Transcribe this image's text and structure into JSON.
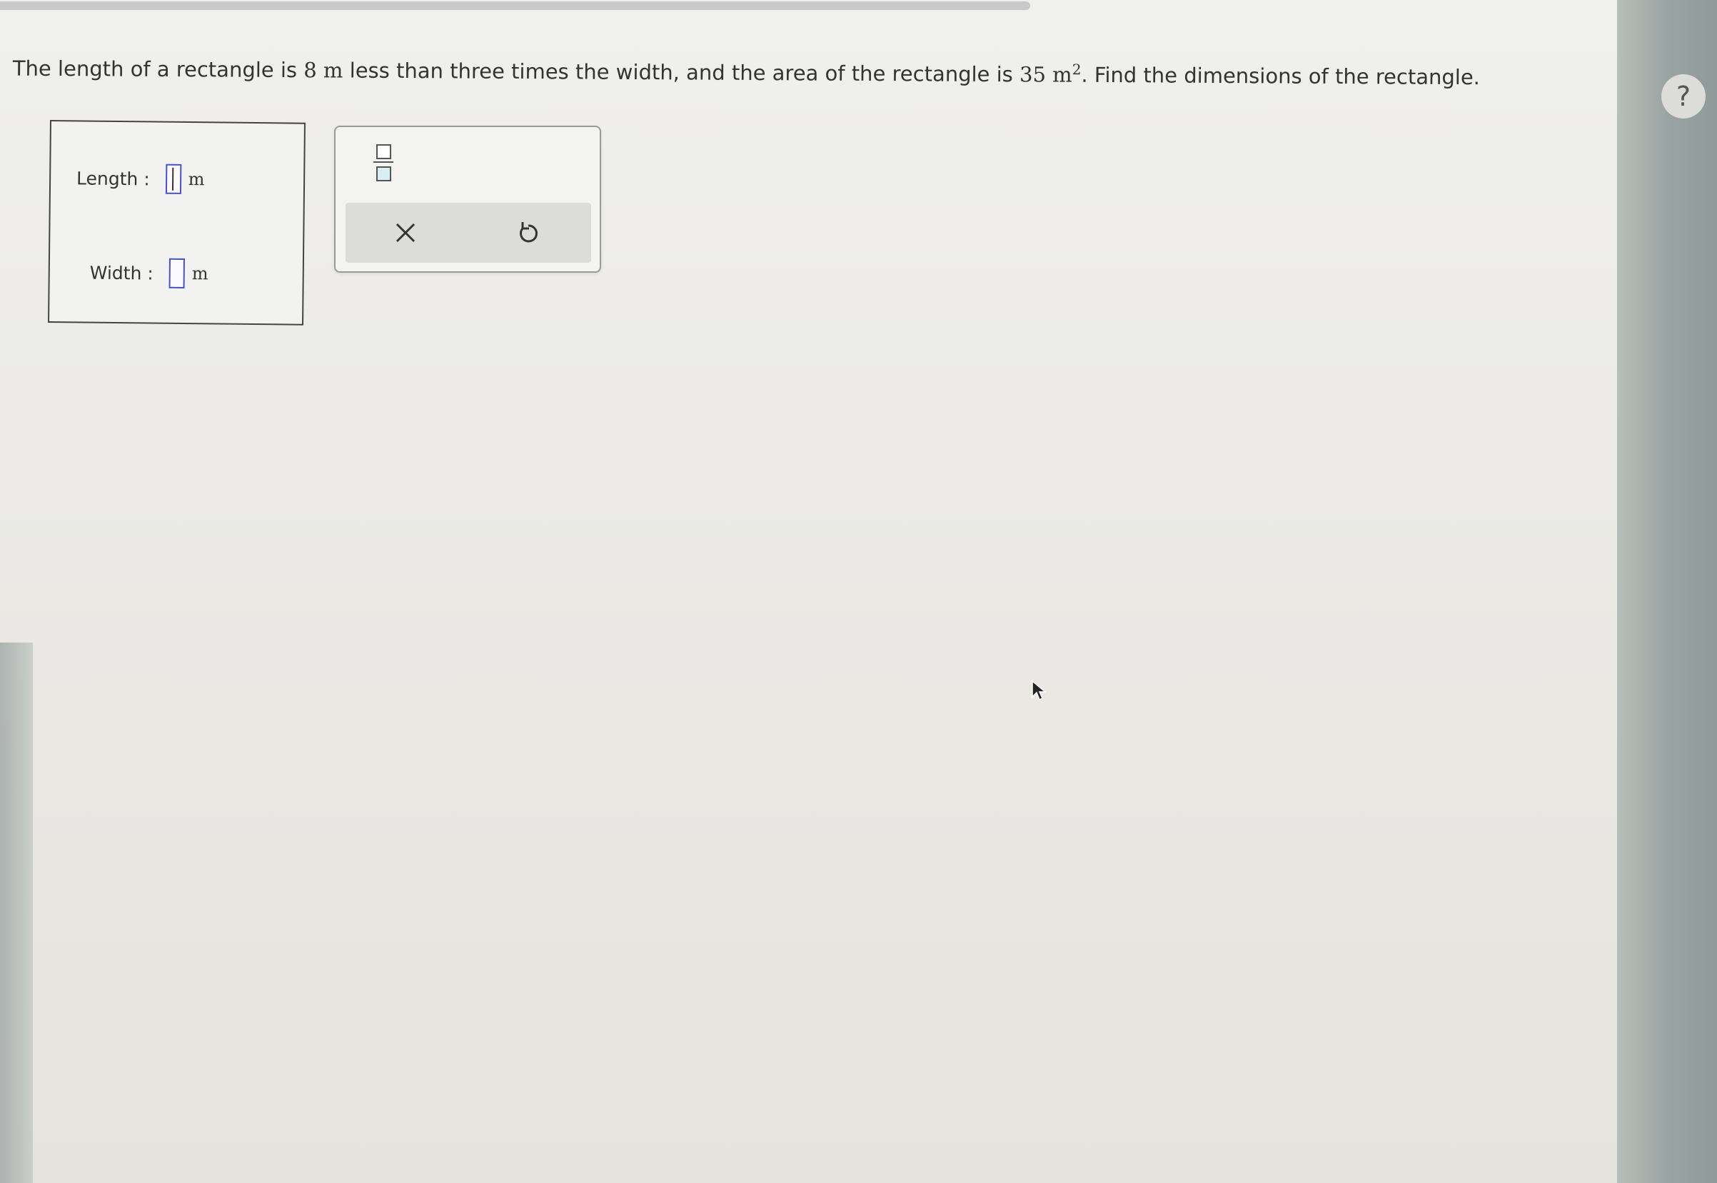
{
  "progress": {
    "fill_fraction": 0.6
  },
  "question": {
    "text_1": "The length of a rectangle is ",
    "num_1": "8 m",
    "text_2": " less than three times the width, and the area of the rectangle is ",
    "num_2": "35 m",
    "exponent": "2",
    "text_3": ". Find the dimensions of the rectangle."
  },
  "help": {
    "label": "?"
  },
  "answers": {
    "length": {
      "label": "Length :",
      "value": "",
      "unit": "m"
    },
    "width": {
      "label": "Width :",
      "value": "",
      "unit": "m"
    }
  },
  "toolbox": {
    "fraction_icon": "fraction-template-icon",
    "clear_icon": "close-x-icon",
    "undo_icon": "undo-icon"
  },
  "colors": {
    "input_border": "#4a4fd6",
    "text": "#333333"
  }
}
